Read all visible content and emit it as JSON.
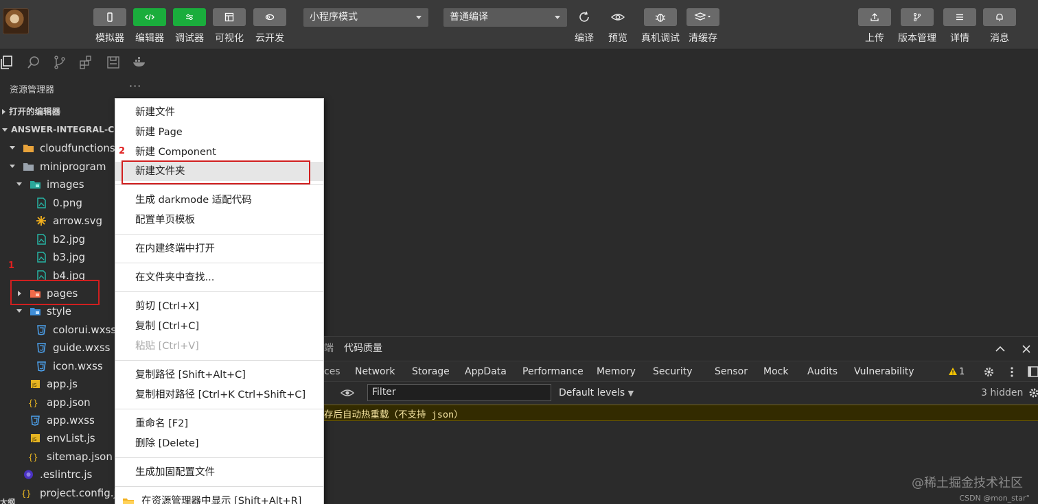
{
  "toolbar": {
    "left_buttons": [
      {
        "label": "模拟器",
        "icon": "phone-icon"
      },
      {
        "label": "编辑器",
        "icon": "code-icon"
      },
      {
        "label": "调试器",
        "icon": "debug-sliders-icon"
      },
      {
        "label": "可视化",
        "icon": "layout-icon"
      },
      {
        "label": "云开发",
        "icon": "cloud-icon"
      }
    ],
    "mode_select": "小程序模式",
    "compile_select": "普通编译",
    "mid_buttons": [
      {
        "label": "编译",
        "icon": "refresh-icon"
      },
      {
        "label": "预览",
        "icon": "eye-icon"
      },
      {
        "label": "真机调试",
        "icon": "bug-icon"
      },
      {
        "label": "清缓存",
        "icon": "layers-icon"
      }
    ],
    "right_buttons": [
      {
        "label": "上传",
        "icon": "upload-icon"
      },
      {
        "label": "版本管理",
        "icon": "branch-icon"
      },
      {
        "label": "详情",
        "icon": "menu-icon"
      },
      {
        "label": "消息",
        "icon": "bell-icon"
      }
    ]
  },
  "explorer": {
    "title": "资源管理器",
    "more": "···",
    "open_editors": "打开的编辑器",
    "project": "ANSWER-INTEGRAL-CON",
    "tree": [
      {
        "name": "cloudfunctions |",
        "kind": "folder"
      },
      {
        "name": "miniprogram",
        "kind": "folder"
      },
      {
        "name": "images",
        "kind": "folder"
      },
      {
        "name": "0.png",
        "kind": "image"
      },
      {
        "name": "arrow.svg",
        "kind": "svg"
      },
      {
        "name": "b2.jpg",
        "kind": "image"
      },
      {
        "name": "b3.jpg",
        "kind": "image"
      },
      {
        "name": "b4.jpg",
        "kind": "image"
      },
      {
        "name": "pages",
        "kind": "folder"
      },
      {
        "name": "style",
        "kind": "folder"
      },
      {
        "name": "colorui.wxss",
        "kind": "wxss"
      },
      {
        "name": "guide.wxss",
        "kind": "wxss"
      },
      {
        "name": "icon.wxss",
        "kind": "wxss"
      },
      {
        "name": "app.js",
        "kind": "js"
      },
      {
        "name": "app.json",
        "kind": "json"
      },
      {
        "name": "app.wxss",
        "kind": "wxss"
      },
      {
        "name": "envList.js",
        "kind": "js"
      },
      {
        "name": "sitemap.json",
        "kind": "json"
      },
      {
        "name": ".eslintrc.js",
        "kind": "eslint"
      },
      {
        "name": "project.config.js",
        "kind": "json"
      }
    ],
    "bottom_section": "大纲"
  },
  "annotations": {
    "step1": "1",
    "step2": "2"
  },
  "context_menu": {
    "items": [
      {
        "label": "新建文件",
        "state": "normal"
      },
      {
        "label": "新建 Page",
        "state": "normal"
      },
      {
        "label": "新建 Component",
        "state": "normal"
      },
      {
        "label": "新建文件夹",
        "state": "active"
      },
      {
        "label": "生成 darkmode 适配代码",
        "state": "normal"
      },
      {
        "label": "配置单页模板",
        "state": "normal"
      },
      {
        "label": "在内建终端中打开",
        "state": "normal"
      },
      {
        "label": "在文件夹中查找...",
        "state": "normal"
      },
      {
        "label": "剪切  [Ctrl+X]",
        "state": "normal"
      },
      {
        "label": "复制  [Ctrl+C]",
        "state": "normal"
      },
      {
        "label": "粘贴  [Ctrl+V]",
        "state": "disabled"
      },
      {
        "label": "复制路径  [Shift+Alt+C]",
        "state": "normal"
      },
      {
        "label": "复制相对路径  [Ctrl+K Ctrl+Shift+C]",
        "state": "normal"
      },
      {
        "label": "重命名  [F2]",
        "state": "normal"
      },
      {
        "label": "删除  [Delete]",
        "state": "normal"
      },
      {
        "label": "生成加固配置文件",
        "state": "normal"
      },
      {
        "label": "在资源管理器中显示  [Shift+Alt+R]",
        "state": "normal"
      }
    ]
  },
  "devtools": {
    "top_tabs": [
      "端",
      "代码质量"
    ],
    "tabs": [
      "ces",
      "Network",
      "Storage",
      "AppData",
      "Performance",
      "Memory",
      "Security",
      "Sensor",
      "Mock",
      "Audits",
      "Vulnerability"
    ],
    "warning_count": "1",
    "filter_placeholder": "Filter",
    "levels": "Default levels",
    "hidden": "3 hidden",
    "console_message": "存后自动热重载（不支持 json）"
  },
  "watermark": "@稀土掘金技术社区",
  "credit": "CSDN @mon_star°",
  "colors": {
    "accent_green": "#1aad3c",
    "highlight_red": "#d11f1f"
  }
}
